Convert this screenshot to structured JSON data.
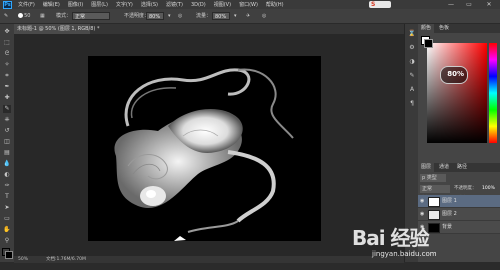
{
  "menubar": {
    "logo": "Ps",
    "items": [
      "文件(F)",
      "编辑(E)",
      "图像(I)",
      "图层(L)",
      "文字(Y)",
      "选择(S)",
      "滤镜(T)",
      "3D(D)",
      "视图(V)",
      "窗口(W)",
      "帮助(H)"
    ],
    "sogou_label": "S",
    "minimize": "—",
    "restore": "▭",
    "close": "✕"
  },
  "options": {
    "brush_size": "50",
    "mode_label": "模式：",
    "mode_value": "正常",
    "opacity_label": "不透明度：",
    "opacity_value": "80%",
    "flow_label": "流量：",
    "flow_value": "80%"
  },
  "document": {
    "tab_label": "未标题-1 @ 50% (图层 1, RGB/8) *",
    "zoom": "50%",
    "doc_info": "文档:1.76M/6.70M"
  },
  "panels": {
    "top_tabs": [
      "颜色",
      "色板"
    ],
    "color_badge": "80%",
    "layers_tabs": [
      "图层",
      "通道",
      "路径"
    ],
    "kind_label": "p 类型",
    "blend_mode": "正常",
    "opacity_label": "不透明度：",
    "opacity_value": "100%",
    "lock_label": "锁定：",
    "fill_label": "填充：",
    "fill_value": "100%",
    "layers": [
      {
        "name": "图层 1",
        "visible": true,
        "selected": true
      },
      {
        "name": "图层 2",
        "visible": true,
        "selected": false
      },
      {
        "name": "背景",
        "visible": true,
        "selected": false
      }
    ]
  },
  "watermark": {
    "brand": "Bai 经验",
    "url": "jingyan.baidu.com"
  },
  "colors": {
    "foreground": "#ffffff",
    "background": "#000000"
  }
}
